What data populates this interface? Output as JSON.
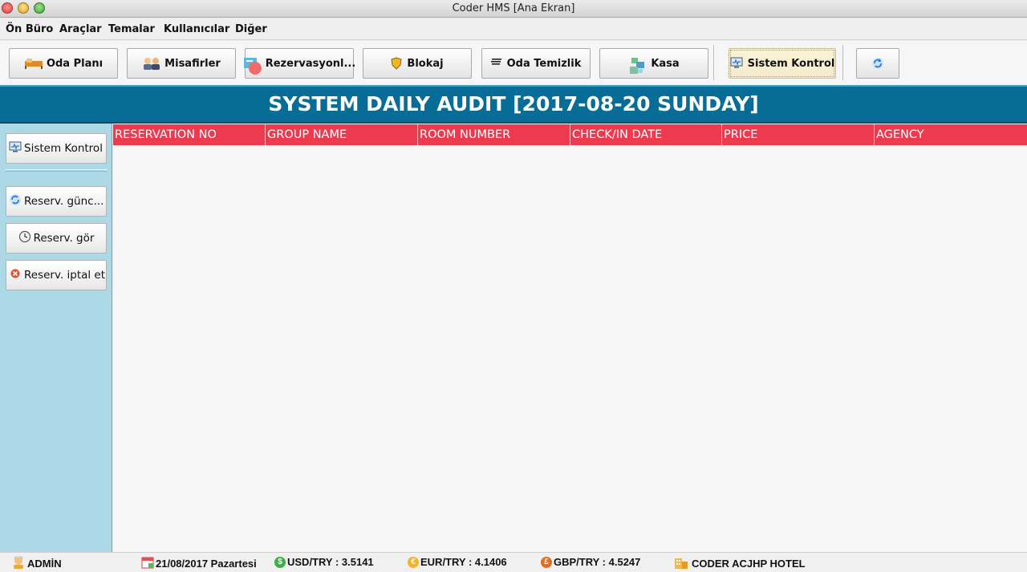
{
  "window": {
    "title": "Coder HMS [Ana Ekran]"
  },
  "menu": {
    "items": [
      "Ön Büro",
      "Araçlar",
      "Temalar",
      "Kullanıcılar",
      "Diğer"
    ]
  },
  "toolbar": {
    "buttons": [
      {
        "label": "Oda Planı",
        "icon": "bed-icon"
      },
      {
        "label": "Misafirler",
        "icon": "guests-icon"
      },
      {
        "label": "Rezervasyonl...",
        "icon": "reservation-icon"
      },
      {
        "label": "Blokaj",
        "icon": "shield-icon"
      },
      {
        "label": "Oda Temizlik",
        "icon": "list-icon"
      },
      {
        "label": "Kasa",
        "icon": "cash-register-icon"
      },
      {
        "label": "Sistem Kontrol",
        "icon": "monitor-icon"
      },
      {
        "label": "",
        "icon": "refresh-icon"
      }
    ],
    "active_index": 6
  },
  "banner": {
    "title": "SYSTEM DAILY AUDIT [2017-08-20 SUNDAY]"
  },
  "sidebar": {
    "buttons": [
      {
        "label": "Sistem Kontrol",
        "icon": "monitor-icon"
      },
      {
        "label": "Reserv. günc...",
        "icon": "refresh-icon"
      },
      {
        "label": "Reserv. gör",
        "icon": "clock-icon"
      },
      {
        "label": "Reserv. iptal et",
        "icon": "cancel-icon"
      }
    ]
  },
  "table": {
    "columns": [
      "RESERVATION NO",
      "GROUP NAME",
      "ROOM NUMBER",
      "CHECK/IN DATE",
      "PRICE",
      "AGENCY"
    ],
    "rows": []
  },
  "status": {
    "user": "ADMİN",
    "date": "21/08/2017 Pazartesi",
    "usd": "USD/TRY : 3.5141",
    "eur": "EUR/TRY : 4.1406",
    "gbp": "GBP/TRY : 4.5247",
    "hotel": "CODER ACJHP HOTEL"
  },
  "colors": {
    "banner": "#086d96",
    "table_header": "#ee3a4f",
    "sidebar": "#add8e6"
  }
}
